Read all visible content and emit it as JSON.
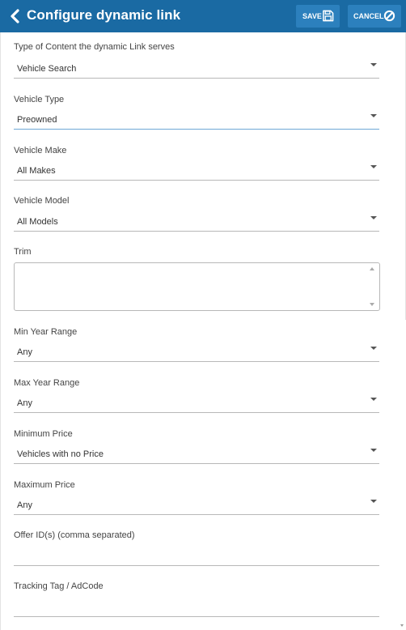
{
  "header": {
    "title": "Configure dynamic link",
    "save_label": "SAVE",
    "cancel_label": "CANCEL",
    "background": "#1a6aa3",
    "button_background": "#2c80bd"
  },
  "fields": {
    "content_type": {
      "label": "Type of Content the dynamic Link serves",
      "value": "Vehicle Search"
    },
    "vehicle_type": {
      "label": "Vehicle Type",
      "value": "Preowned"
    },
    "vehicle_make": {
      "label": "Vehicle Make",
      "value": "All Makes"
    },
    "vehicle_model": {
      "label": "Vehicle Model",
      "value": "All Models"
    },
    "trim": {
      "label": "Trim",
      "value": ""
    },
    "min_year": {
      "label": "Min Year Range",
      "value": "Any"
    },
    "max_year": {
      "label": "Max Year Range",
      "value": "Any"
    },
    "min_price": {
      "label": "Minimum Price",
      "value": "Vehicles with no Price"
    },
    "max_price": {
      "label": "Maximum Price",
      "value": "Any"
    },
    "offer_ids": {
      "label": "Offer ID(s) (comma separated)",
      "value": ""
    },
    "tracking_tag": {
      "label": "Tracking Tag / AdCode",
      "value": ""
    }
  },
  "icons": {
    "back": "chevron-left-icon",
    "save": "floppy-disk-icon",
    "cancel": "ban-icon"
  }
}
